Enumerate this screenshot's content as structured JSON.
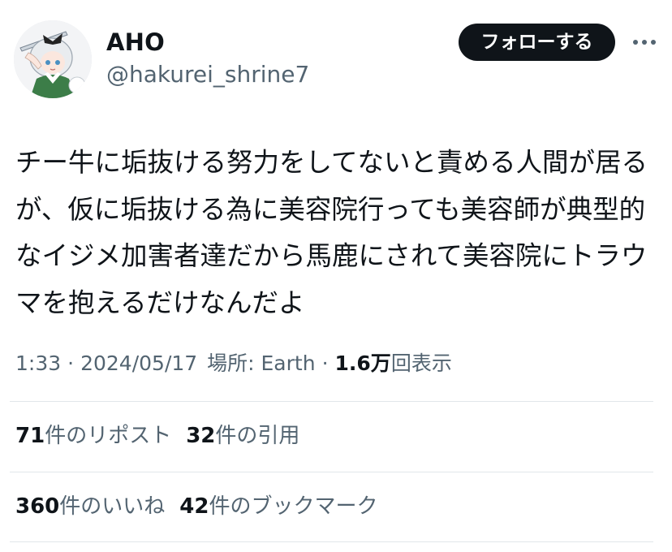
{
  "author": {
    "display_name": "AHO",
    "handle": "@hakurei_shrine7",
    "avatar_icon": "anime-character-avatar"
  },
  "follow_button": {
    "label": "フォローする"
  },
  "more_button": {
    "icon": "more-horizontal-icon"
  },
  "tweet": {
    "text": "チー牛に垢抜ける努力をしてないと責める人間が居るが、仮に垢抜ける為に美容院行っても美容師が典型的なイジメ加害者達だから馬鹿にされて美容院にトラウマを抱えるだけなんだよ"
  },
  "meta": {
    "time": "1:33",
    "separator": "·",
    "date": "2024/05/17",
    "location_label": "場所: Earth",
    "views_count": "1.6万",
    "views_label": "回表示"
  },
  "stats": {
    "reposts": {
      "count": "71",
      "label": "件のリポスト"
    },
    "quotes": {
      "count": "32",
      "label": "件の引用"
    },
    "likes": {
      "count": "360",
      "label": "件のいいね"
    },
    "bookmarks": {
      "count": "42",
      "label": "件のブックマーク"
    }
  },
  "colors": {
    "text_primary": "#0f1419",
    "text_secondary": "#536471",
    "divider": "#e1e6ea",
    "button_bg": "#0f1419",
    "button_text": "#ffffff"
  }
}
